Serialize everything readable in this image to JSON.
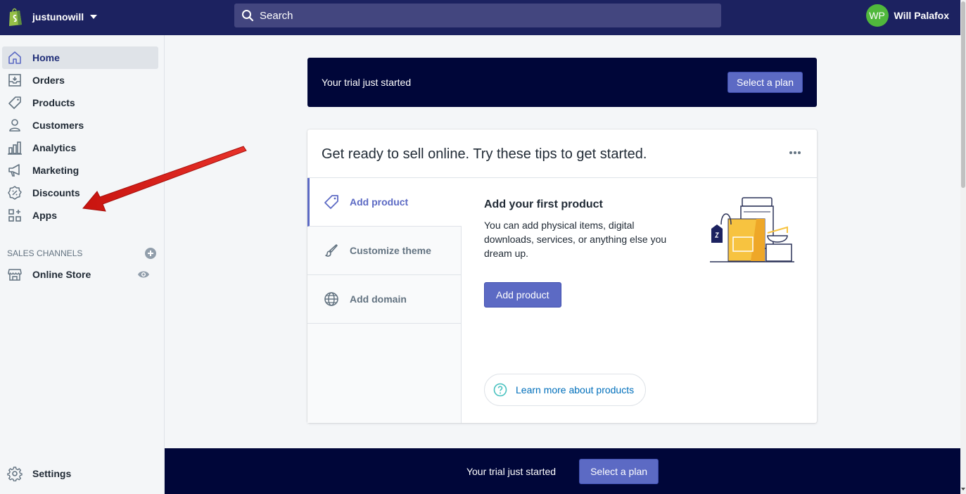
{
  "topbar": {
    "store_name": "justunowill",
    "search_placeholder": "Search",
    "user_initials": "WP",
    "user_name": "Will Palafox"
  },
  "sidebar": {
    "items": [
      {
        "label": "Home",
        "icon": "home-icon",
        "active": true
      },
      {
        "label": "Orders",
        "icon": "orders-icon"
      },
      {
        "label": "Products",
        "icon": "tag-icon"
      },
      {
        "label": "Customers",
        "icon": "person-icon"
      },
      {
        "label": "Analytics",
        "icon": "bar-chart-icon"
      },
      {
        "label": "Marketing",
        "icon": "megaphone-icon"
      },
      {
        "label": "Discounts",
        "icon": "discount-icon"
      },
      {
        "label": "Apps",
        "icon": "apps-icon"
      }
    ],
    "channels_heading": "SALES CHANNELS",
    "online_store": "Online Store",
    "settings": "Settings"
  },
  "banner": {
    "text": "Your trial just started",
    "button": "Select a plan"
  },
  "card": {
    "title": "Get ready to sell online. Try these tips to get started.",
    "tabs": [
      {
        "label": "Add product",
        "icon": "tag-icon",
        "active": true
      },
      {
        "label": "Customize theme",
        "icon": "brush-icon"
      },
      {
        "label": "Add domain",
        "icon": "globe-icon"
      }
    ],
    "pane": {
      "title": "Add your first product",
      "description": "You can add physical items, digital downloads, services, or anything else you dream up.",
      "button": "Add product",
      "learn_more": "Learn more about products"
    }
  },
  "footer_bar": {
    "text": "Your trial just started",
    "button": "Select a plan"
  },
  "colors": {
    "topbar": "#1c2260",
    "banner": "#000639",
    "primary": "#5c6ac4",
    "avatar": "#50b83c",
    "link": "#006fbb",
    "annotation_arrow": "#e3201b"
  }
}
